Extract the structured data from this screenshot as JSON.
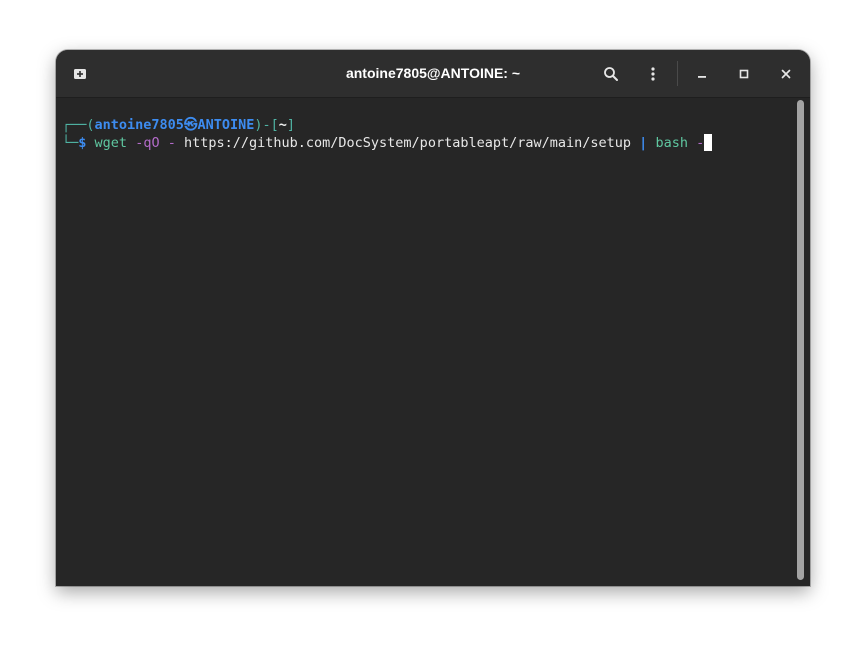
{
  "window": {
    "title": "antoine7805@ANTOINE: ~",
    "buttons": {
      "new_tab": "new-tab-icon",
      "search": "search-icon",
      "menu": "kebab-menu-icon",
      "minimize": "minimize-icon",
      "maximize": "maximize-icon",
      "close": "close-icon"
    }
  },
  "terminal": {
    "prompt": {
      "corner_top": "┌──",
      "open_paren": "(",
      "user": "antoine7805",
      "at_symbol": "㉿",
      "host": "ANTOINE",
      "close_paren": ")",
      "dash": "-",
      "dir_open": "[",
      "cwd": "~",
      "dir_close": "]",
      "corner_bottom": "└─",
      "dollar": "$"
    },
    "command": {
      "program": "wget",
      "flags": "-qO -",
      "url": "https://github.com/DocSystem/portableapt/raw/main/setup",
      "pipe": "|",
      "pipe_program": "bash",
      "pipe_arg": "-"
    }
  },
  "colors": {
    "background": "#262626",
    "titlebar": "#2e2e2e",
    "prompt_blue": "#3d8cf0",
    "prompt_teal": "#4fb3a3",
    "command_green": "#5fc7a0",
    "option_purple": "#b36bc9"
  }
}
